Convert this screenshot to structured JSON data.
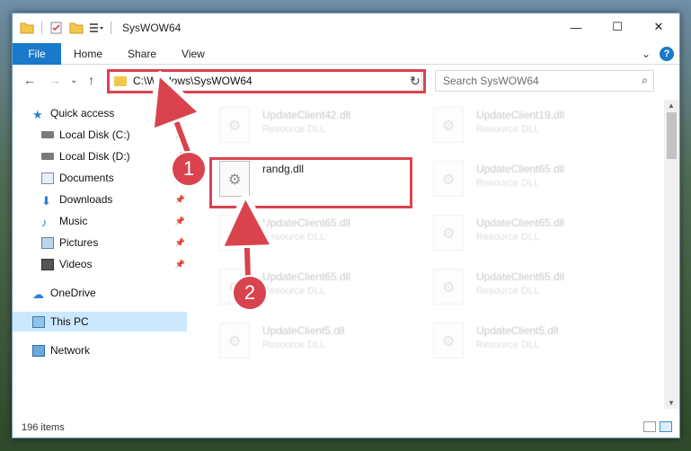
{
  "window": {
    "title": "SysWOW64",
    "controls": [
      "—",
      "☐",
      "✕"
    ]
  },
  "ribbon": {
    "file": "File",
    "tabs": [
      "Home",
      "Share",
      "View"
    ],
    "expand": "⌄",
    "help": "?"
  },
  "address": {
    "path": "C:\\Windows\\SysWOW64",
    "search_placeholder": "Search SysWOW64"
  },
  "nav": {
    "items": [
      {
        "label": "Quick access",
        "icon": "star-icon",
        "pinned": false
      },
      {
        "label": "Local Disk (C:)",
        "icon": "drive-icon",
        "pinned": true
      },
      {
        "label": "Local Disk (D:)",
        "icon": "drive-icon",
        "pinned": true
      },
      {
        "label": "Documents",
        "icon": "documents-icon",
        "pinned": true
      },
      {
        "label": "Downloads",
        "icon": "download-icon",
        "pinned": true
      },
      {
        "label": "Music",
        "icon": "music-icon",
        "pinned": true
      },
      {
        "label": "Pictures",
        "icon": "pictures-icon",
        "pinned": true
      },
      {
        "label": "Videos",
        "icon": "videos-icon",
        "pinned": true
      },
      {
        "label": "OneDrive",
        "icon": "cloud-icon",
        "pinned": false
      },
      {
        "label": "This PC",
        "icon": "computer-icon",
        "pinned": false,
        "selected": true
      },
      {
        "label": "Network",
        "icon": "network-icon",
        "pinned": false
      }
    ]
  },
  "files": [
    {
      "name": "UpdateClient42.dll",
      "type": "Resource DLL"
    },
    {
      "name": "UpdateClient19.dll",
      "type": "Resource DLL"
    },
    {
      "name": "randg.dll",
      "type": ""
    },
    {
      "name": "UpdateClient65.dll",
      "type": "Resource DLL"
    },
    {
      "name": "UpdateClient65.dll",
      "type": "Resource DLL"
    },
    {
      "name": "UpdateClient65.dll",
      "type": "Resource DLL"
    },
    {
      "name": "UpdateClient65.dll",
      "type": "Resource DLL"
    },
    {
      "name": "UpdateClient65.dll",
      "type": "Resource DLL"
    },
    {
      "name": "UpdateClient5.dll",
      "type": "Resource DLL"
    },
    {
      "name": "UpdateClient5.dll",
      "type": "Resource DLL"
    }
  ],
  "status": {
    "count": "196 items"
  },
  "annotations": {
    "step1": "1",
    "step2": "2",
    "color": "#d9434e"
  }
}
